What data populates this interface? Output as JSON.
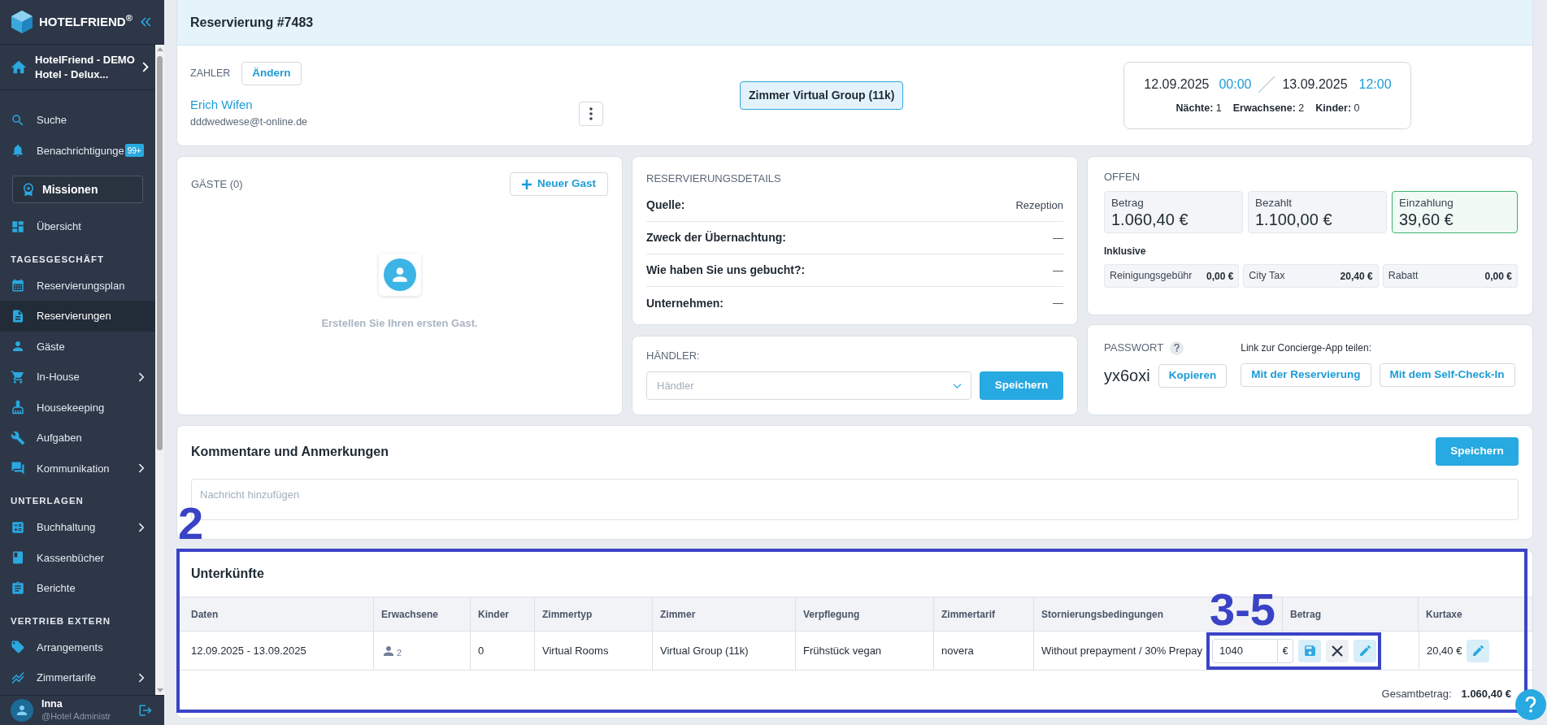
{
  "sidebar": {
    "brand": "HOTELFRIEND$^{®}$",
    "property": {
      "line1": "HotelFriend - DEMO",
      "line2": "Hotel - Delux..."
    },
    "sections": [
      {
        "items": [
          {
            "kind": "link",
            "label": "Suche",
            "selected": false,
            "expandable": false
          },
          {
            "kind": "link",
            "label": "Benachrichtigunge",
            "badge": "99+",
            "selected": false,
            "expandable": false
          },
          {
            "kind": "boxed",
            "label": "Missionen",
            "selected": false,
            "expandable": false
          },
          {
            "kind": "link",
            "label": "Übersicht",
            "selected": false,
            "expandable": false
          }
        ]
      },
      {
        "heading": "TAGESGESCHÄFT",
        "items": [
          {
            "kind": "link",
            "label": "Reservierungsplan",
            "selected": false,
            "expandable": false
          },
          {
            "kind": "link",
            "label": "Reservierungen",
            "selected": true,
            "expandable": false
          },
          {
            "kind": "link",
            "label": "Gäste",
            "selected": false,
            "expandable": false
          },
          {
            "kind": "link",
            "label": "In-House",
            "selected": false,
            "expandable": true
          },
          {
            "kind": "link",
            "label": "Housekeeping",
            "selected": false,
            "expandable": false
          },
          {
            "kind": "link",
            "label": "Aufgaben",
            "selected": false,
            "expandable": false
          },
          {
            "kind": "link",
            "label": "Kommunikation",
            "selected": false,
            "expandable": true
          }
        ]
      },
      {
        "heading": "UNTERLAGEN",
        "items": [
          {
            "kind": "link",
            "label": "Buchhaltung",
            "selected": false,
            "expandable": true
          },
          {
            "kind": "link",
            "label": "Kassenbücher",
            "selected": false,
            "expandable": false
          },
          {
            "kind": "link",
            "label": "Berichte",
            "selected": false,
            "expandable": false
          }
        ]
      },
      {
        "heading": "VERTRIEB EXTERN",
        "items": [
          {
            "kind": "link",
            "label": "Arrangements",
            "selected": false,
            "expandable": false
          },
          {
            "kind": "link",
            "label": "Zimmertarife",
            "selected": false,
            "expandable": true
          }
        ]
      }
    ],
    "user": {
      "name": "Inna",
      "role": "@Hotel Administr"
    }
  },
  "reservation": {
    "title": "Reservierung #7483",
    "payer_label": "ZAHLER",
    "change_button": "Ändern",
    "guest_name": "Erich Wifen",
    "guest_email": "dddwedwese@t-online.de",
    "room_tag": "Zimmer Virtual Group (11k)",
    "stay": {
      "arrival_date": "12.09.2025",
      "arrival_time": "00:00",
      "departure_date": "13.09.2025",
      "departure_time": "12:00",
      "stats": [
        {
          "label": "Nächte:",
          "value": "1"
        },
        {
          "label": "Erwachsene:",
          "value": "2"
        },
        {
          "label": "Kinder:",
          "value": "0"
        }
      ]
    }
  },
  "guests": {
    "title": "GÄSTE (0)",
    "add_button": "Neuer Gast",
    "empty_text": "Erstellen Sie Ihren ersten Gast."
  },
  "details": {
    "title": "RESERVIERUNGSDETAILS",
    "rows": [
      {
        "label": "Quelle:",
        "value": "Rezeption"
      },
      {
        "label": "Zweck der Übernachtung:",
        "value": "—"
      },
      {
        "label": "Wie haben Sie uns gebucht?:",
        "value": "—"
      },
      {
        "label": "Unternehmen:",
        "value": "—"
      }
    ]
  },
  "dealer": {
    "label": "HÄNDLER:",
    "placeholder": "Händler",
    "save_button": "Speichern"
  },
  "balance": {
    "title": "OFFEN",
    "totals": [
      {
        "label": "Betrag",
        "value": "1.060,40 €",
        "highlighted": false
      },
      {
        "label": "Bezahlt",
        "value": "1.100,00 €",
        "highlighted": false
      },
      {
        "label": "Einzahlung",
        "value": "39,60 €",
        "highlighted": true
      }
    ],
    "included_label": "Inklusive",
    "included": [
      {
        "label": "Reinigungsgebühr",
        "value": "0,00 €"
      },
      {
        "label": "City Tax",
        "value": "20,40 €"
      },
      {
        "label": "Rabatt",
        "value": "0,00 €"
      }
    ]
  },
  "password": {
    "label": "PASSWORT",
    "value": "yx6oxi",
    "copy_button": "Kopieren",
    "share_label": "Link zur Concierge-App teilen:",
    "share_buttons": [
      "Mit der Reservierung",
      "Mit dem Self-Check-In"
    ]
  },
  "comments": {
    "title": "Kommentare und Anmerkungen",
    "save_button": "Speichern",
    "placeholder": "Nachricht hinzufügen"
  },
  "accommodations": {
    "annotation": "2",
    "title": "Unterkünfte",
    "columns": [
      "Daten",
      "Erwachsene",
      "Kinder",
      "Zimmertyp",
      "Zimmer",
      "Verpflegung",
      "Zimmertarif",
      "Stornierungsbedingungen",
      "Betrag",
      "Kurtaxe"
    ],
    "rows": [
      {
        "dates": "12.09.2025 - 13.09.2025",
        "adults": "2",
        "children": "0",
        "room_type": "Virtual Rooms",
        "room": "Virtual Group (11k)",
        "board": "Frühstück vegan",
        "rate": "novera",
        "cancellation": "Without prepayment / 30% Prepay",
        "amount": {
          "value": "1040",
          "currency": "€",
          "editing": true,
          "annotation": "3-5"
        },
        "city_tax": "20,40 €"
      }
    ],
    "total_label": "Gesamtbetrag:",
    "total_value": "1.060,40 €"
  }
}
